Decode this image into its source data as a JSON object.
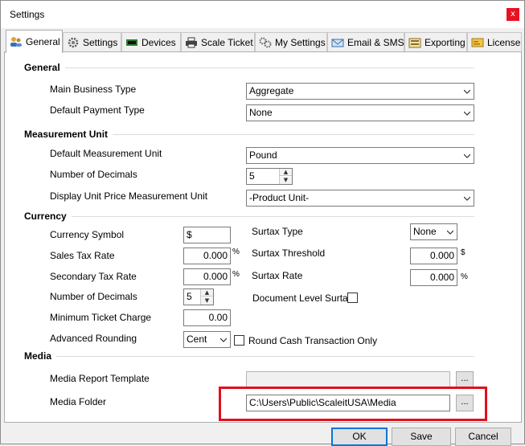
{
  "window": {
    "title": "Settings",
    "close_glyph": "x"
  },
  "tabs": [
    {
      "label": "General",
      "icon": "users-icon",
      "active": true
    },
    {
      "label": "Settings",
      "icon": "gear-icon"
    },
    {
      "label": "Devices",
      "icon": "device-icon"
    },
    {
      "label": "Scale Ticket",
      "icon": "printer-icon"
    },
    {
      "label": "My Settings",
      "icon": "gears-icon"
    },
    {
      "label": "Email & SMS",
      "icon": "email-icon"
    },
    {
      "label": "Exporting",
      "icon": "export-icon"
    },
    {
      "label": "License",
      "icon": "license-icon"
    }
  ],
  "general": {
    "title": "General",
    "main_business_type_label": "Main Business Type",
    "main_business_type_value": "Aggregate",
    "default_payment_type_label": "Default Payment Type",
    "default_payment_type_value": "None"
  },
  "measurement": {
    "title": "Measurement Unit",
    "default_unit_label": "Default Measurement Unit",
    "default_unit_value": "Pound",
    "decimals_label": "Number of Decimals",
    "decimals_value": "5",
    "display_unit_price_label": "Display Unit Price Measurement Unit",
    "display_unit_price_value": "-Product Unit-"
  },
  "currency": {
    "title": "Currency",
    "symbol_label": "Currency Symbol",
    "symbol_value": "$",
    "sales_tax_label": "Sales Tax Rate",
    "sales_tax_value": "0.000",
    "sales_tax_unit": "%",
    "secondary_tax_label": "Secondary Tax Rate",
    "secondary_tax_value": "0.000",
    "secondary_tax_unit": "%",
    "decimals_label": "Number of Decimals",
    "decimals_value": "5",
    "min_ticket_label": "Minimum Ticket Charge",
    "min_ticket_value": "0.00",
    "rounding_label": "Advanced Rounding",
    "rounding_value": "Cent",
    "round_cash_label": "Round Cash Transaction Only",
    "surtax_type_label": "Surtax Type",
    "surtax_type_value": "None",
    "surtax_threshold_label": "Surtax Threshold",
    "surtax_threshold_value": "0.000",
    "surtax_threshold_unit": "$",
    "surtax_rate_label": "Surtax Rate",
    "surtax_rate_value": "0.000",
    "surtax_rate_unit": "%",
    "doc_level_surtax_label": "Document Level Surtax"
  },
  "media": {
    "title": "Media",
    "report_template_label": "Media Report Template",
    "report_template_value": "",
    "folder_label": "Media Folder",
    "folder_value": "C:\\Users\\Public\\ScaleitUSA\\Media",
    "browse_label": "..."
  },
  "buttons": {
    "ok": "OK",
    "save": "Save",
    "cancel": "Cancel"
  }
}
